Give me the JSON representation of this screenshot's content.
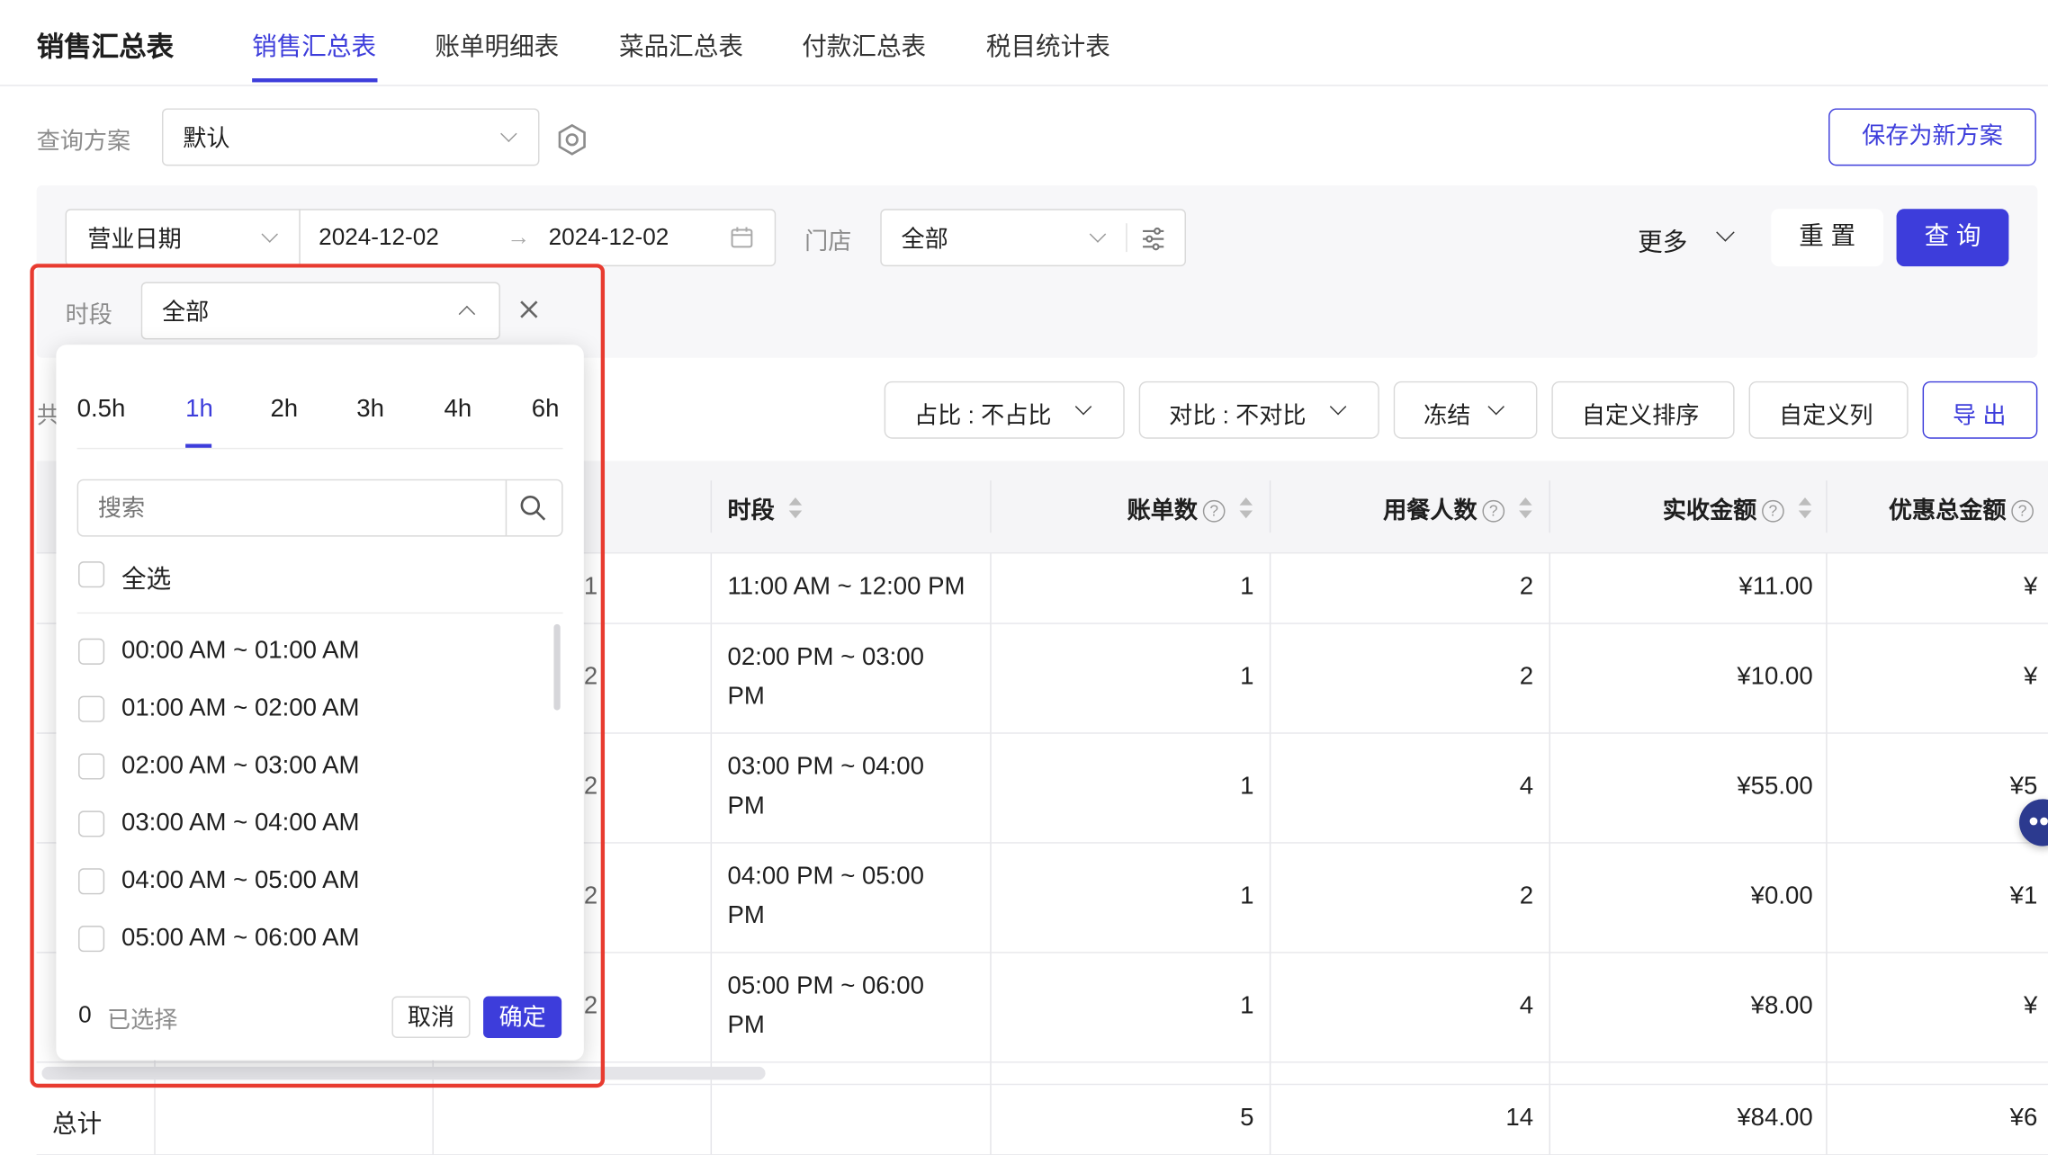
{
  "header": {
    "app_title": "销售汇总表",
    "tabs": [
      "销售汇总表",
      "账单明细表",
      "菜品汇总表",
      "付款汇总表",
      "税目统计表"
    ]
  },
  "scheme": {
    "label": "查询方案",
    "value": "默认",
    "save_button": "保存为新方案"
  },
  "filters": {
    "date_type": "营业日期",
    "date_start": "2024-12-02",
    "date_sep": "→",
    "date_end": "2024-12-02",
    "store_label": "门店",
    "store_value": "全部",
    "more": "更多",
    "reset": "重 置",
    "query": "查 询",
    "period_label": "时段",
    "period_value": "全部"
  },
  "toolbar": {
    "count_prefix": "共",
    "ratio": "占比 : 不占比",
    "compare": "对比 : 不对比",
    "freeze": "冻结",
    "custom_sort": "自定义排序",
    "custom_cols": "自定义列",
    "export": "导 出"
  },
  "table": {
    "headers": {
      "period": "时段",
      "bills": "账单数",
      "diners": "用餐人数",
      "received": "实收金额",
      "discount": "优惠总金额"
    },
    "rows": [
      {
        "col2": "1",
        "period1": "11:00 AM ~ 12:00 PM",
        "period2": "",
        "bills": "1",
        "diners": "2",
        "received": "¥11.00",
        "discount": "¥"
      },
      {
        "col2": "2",
        "period1": "02:00 PM ~ 03:00",
        "period2": "PM",
        "bills": "1",
        "diners": "2",
        "received": "¥10.00",
        "discount": "¥"
      },
      {
        "col2": "2",
        "period1": "03:00 PM ~ 04:00",
        "period2": "PM",
        "bills": "1",
        "diners": "4",
        "received": "¥55.00",
        "discount": "¥5"
      },
      {
        "col2": "2",
        "period1": "04:00 PM ~ 05:00",
        "period2": "PM",
        "bills": "1",
        "diners": "2",
        "received": "¥0.00",
        "discount": "¥1"
      },
      {
        "col2": "2",
        "period1": "05:00 PM ~ 06:00",
        "period2": "PM",
        "bills": "1",
        "diners": "4",
        "received": "¥8.00",
        "discount": "¥"
      }
    ],
    "total": {
      "label": "总计",
      "bills": "5",
      "diners": "14",
      "received": "¥84.00",
      "discount": "¥6"
    }
  },
  "popup": {
    "granularity_tabs": [
      "0.5h",
      "1h",
      "2h",
      "3h",
      "4h",
      "6h"
    ],
    "active_tab": "1h",
    "search_placeholder": "搜索",
    "select_all": "全选",
    "options": [
      "00:00 AM ~ 01:00 AM",
      "01:00 AM ~ 02:00 AM",
      "02:00 AM ~ 03:00 AM",
      "03:00 AM ~ 04:00 AM",
      "04:00 AM ~ 05:00 AM",
      "05:00 AM ~ 06:00 AM"
    ],
    "selected_count": "0",
    "selected_label": "已选择",
    "cancel": "取消",
    "confirm": "确定"
  },
  "colors": {
    "accent": "#3d3ddb",
    "highlight_frame": "#e83b30"
  }
}
